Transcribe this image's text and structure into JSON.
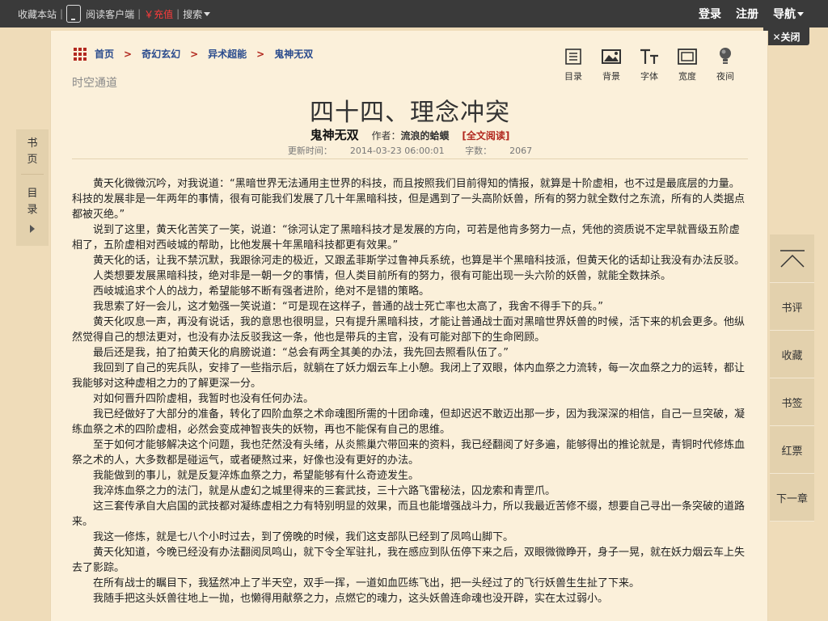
{
  "topbar": {
    "bookmark": "收藏本站",
    "client": "阅读客户端",
    "recharge": "￥充值",
    "search": "搜索",
    "login": "登录",
    "register": "注册",
    "nav": "导航"
  },
  "close_tab": "✕关闭",
  "breadcrumb": {
    "home": "首页",
    "category": "奇幻玄幻",
    "subcategory": "异术超能",
    "book": "鬼神无双",
    "sep": ">"
  },
  "site_name": "时空通道",
  "tools": [
    {
      "label": "目录",
      "icon": "catalog-icon"
    },
    {
      "label": "背景",
      "icon": "background-icon"
    },
    {
      "label": "字体",
      "icon": "font-icon"
    },
    {
      "label": "宽度",
      "icon": "width-icon"
    },
    {
      "label": "夜间",
      "icon": "night-mode-icon"
    }
  ],
  "chapter": {
    "title": "四十四、理念冲突",
    "book": "鬼神无双",
    "author_label": "作者：",
    "author": "流浪的蛤蟆",
    "full_read": "[全文阅读]",
    "update_label": "更新时间：",
    "update_time": "2014-03-23 06:00:01",
    "words_label": "字数：",
    "words": "2067"
  },
  "left_tab": {
    "bookpage": [
      "书",
      "页"
    ],
    "catalog": [
      "目",
      "录"
    ]
  },
  "right_panel": [
    "书评",
    "收藏",
    "书签",
    "红票",
    "下一章"
  ],
  "paragraphs": [
    "黄天化微微沉吟，对我说道：“黑暗世界无法通用主世界的科技，而且按照我们目前得知的情报，就算是十阶虚相，也不过是最底层的力量。科技的发展非是一年两年的事情，很有可能我们发展了几十年黑暗科技，但是遇到了一头高阶妖兽，所有的努力就全数付之东流，所有的人类据点都被灭绝。”",
    "说到了这里，黄天化苦笑了一笑，说道：“徐河认定了黑暗科技才是发展的方向，可若是他肯多努力一点，凭他的资质说不定早就晋级五阶虚相了，五阶虚相对西岐城的帮助，比他发展十年黑暗科技都更有效果。”",
    "黄天化的话，让我不禁沉默，我跟徐河走的极近，又跟孟菲斯学过鲁神兵系统，也算是半个黑暗科技派，但黄天化的话却让我没有办法反驳。",
    "人类想要发展黑暗科技，绝对非是一朝一夕的事情，但人类目前所有的努力，很有可能出现一头六阶的妖兽，就能全数抹杀。",
    "西岐城追求个人的战力，希望能够不断有强者进阶，绝对不是错的策略。",
    "我思索了好一会儿，这才勉强一笑说道：“可是现在这样子，普通的战士死亡率也太高了，我舍不得手下的兵。”",
    "黄天化叹息一声，再没有说话，我的意思也很明显，只有提升黑暗科技，才能让普通战士面对黑暗世界妖兽的时候，活下来的机会更多。他纵然觉得自己的想法更对，也没有办法反驳我这一条，他也是带兵的主官，没有可能对部下的生命罔顾。",
    "最后还是我，拍了拍黄天化的肩膀说道：“总会有两全其美的办法，我先回去照看队伍了。”",
    "我回到了自己的宪兵队，安排了一些指示后，就躺在了妖力烟云车上小憩。我闭上了双眼，体内血祭之力流转，每一次血祭之力的运转，都让我能够对这种虚相之力的了解更深一分。",
    "对如何晋升四阶虚相，我暂时也没有任何办法。",
    "我已经做好了大部分的准备，转化了四阶血祭之术命魂图所需的十团命魂，但却迟迟不敢迈出那一步，因为我深深的相信，自己一旦突破，凝练血祭之术的四阶虚相，必然会变成神智丧失的妖物，再也不能保有自己的思维。",
    "至于如何才能够解决这个问题，我也茫然没有头绪，从炎熊巢穴带回来的资料，我已经翻阅了好多遍，能够得出的推论就是，青铜时代修炼血祭之术的人，大多数都是碰运气，或者硬熬过来，好像也没有更好的办法。",
    "我能做到的事儿，就是反复淬炼血祭之力，希望能够有什么奇迹发生。",
    "我淬炼血祭之力的法门，就是从虚幻之城里得来的三套武技，三十六路飞雷秘法，囚龙索和青罡爪。",
    "这三套传承自大启国的武技都对凝练虚相之力有特别明显的效果，而且也能增强战斗力，所以我最近苦修不缀，想要自己寻出一条突破的道路来。",
    "我这一修炼，就是七八个小时过去，到了傍晚的时候，我们这支部队已经到了凤鸣山脚下。",
    "黄天化知道，今晚已经没有办法翻阅凤鸣山，就下令全军驻扎，我在感应到队伍停下来之后，双眼微微睁开，身子一晃，就在妖力烟云车上失去了影踪。",
    "在所有战士的瞩目下，我猛然冲上了半天空，双手一挥，一道如血匹练飞出，把一头经过了的飞行妖兽生生扯了下来。",
    "我随手把这头妖兽往地上一抛，也懒得用献祭之力，点燃它的魂力，这头妖兽连命魂也没开辟，实在太过弱小。"
  ]
}
